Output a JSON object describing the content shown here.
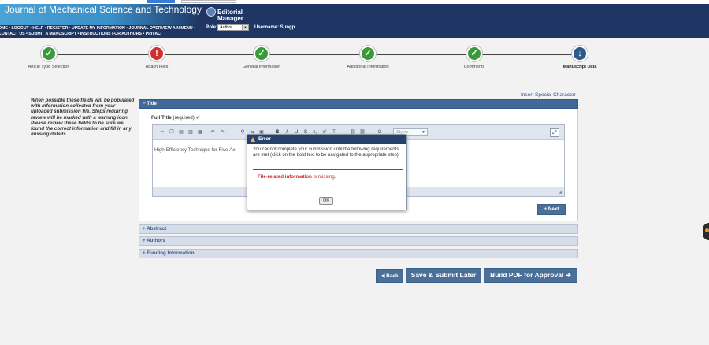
{
  "journal": {
    "title": "Journal of Mechanical Science and Technology"
  },
  "editorial_manager": {
    "label": "Editorial Manager"
  },
  "nav": {
    "links": "OME • LOGOUT • HELP • REGISTER • UPDATE MY INFORMATION • JOURNAL OVERVIEW AIN MENU • CONTACT US • SUBMIT A MANUSCRIPT • INSTRUCTIONS FOR AUTHORS • PRIVAC"
  },
  "user": {
    "role_label": "Role:",
    "role_value": "Author",
    "username": "Username: Sungp"
  },
  "steps": [
    {
      "label": "Article Type Selection",
      "status": "complete",
      "icon": "check-icon"
    },
    {
      "label": "Attach Files",
      "status": "error",
      "icon": "exclamation-icon"
    },
    {
      "label": "General Information",
      "status": "complete",
      "icon": "check-icon"
    },
    {
      "label": "Additional Information",
      "status": "complete",
      "icon": "check-icon"
    },
    {
      "label": "Comments",
      "status": "complete",
      "icon": "check-icon"
    },
    {
      "label": "Manuscript Data",
      "status": "current",
      "icon": "arrow-down-icon"
    }
  ],
  "side_note": "When possible these fields will be populated with information collected from your uploaded submission file. Steps requiring review will be marked with a warning icon. Please review these fields to be sure we found the correct information and fill in any missing details.",
  "insert_special_character": "Insert Special Character",
  "panels": {
    "title": "Title",
    "abstract": "Abstract",
    "authors": "Authors",
    "funding": "Funding Information",
    "expanded_marker": "−",
    "collapsed_marker": "+"
  },
  "full_title": {
    "label": "Full Title",
    "required": "(required)",
    "check": "✔"
  },
  "editor": {
    "styles_placeholder": "Styles",
    "content": "High-Efficiency Technique for Five-Ax"
  },
  "buttons": {
    "next": "+ Next",
    "back": "Back",
    "save": "Save & Submit Later",
    "build_pdf": "Build PDF for Approval"
  },
  "dialog": {
    "title": "Error",
    "message": "You cannot complete your submission until the following requirements are met (click on the bold text to be navigated to the appropriate step):",
    "requirement_bold": "File-related information",
    "requirement_rest": " is missing.",
    "ok": "OK"
  },
  "colors": {
    "header": "#1f3664",
    "accent": "#4a7099",
    "error": "#c62828",
    "success": "#3a9a3a"
  }
}
